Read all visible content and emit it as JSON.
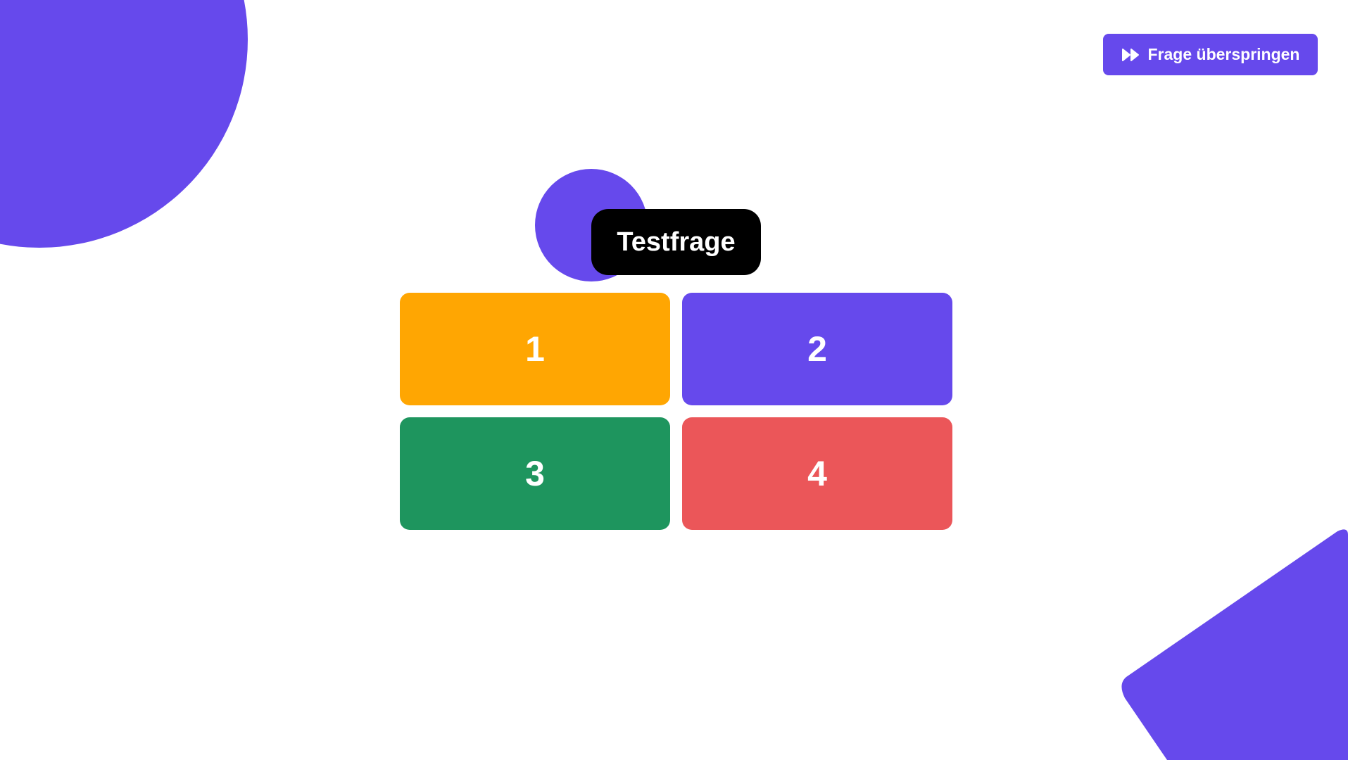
{
  "theme": {
    "accent": "#6649ec",
    "background": "#ffffff",
    "question_bg": "#000000",
    "text_on_color": "#ffffff"
  },
  "header": {
    "skip_button": {
      "label": "Frage überspringen",
      "icon": "fast-forward-icon"
    }
  },
  "question": {
    "text": "Testfrage"
  },
  "answers": [
    {
      "label": "1",
      "color": "#ffa602"
    },
    {
      "label": "2",
      "color": "#6649ec"
    },
    {
      "label": "3",
      "color": "#1e955e"
    },
    {
      "label": "4",
      "color": "#eb5659"
    }
  ]
}
